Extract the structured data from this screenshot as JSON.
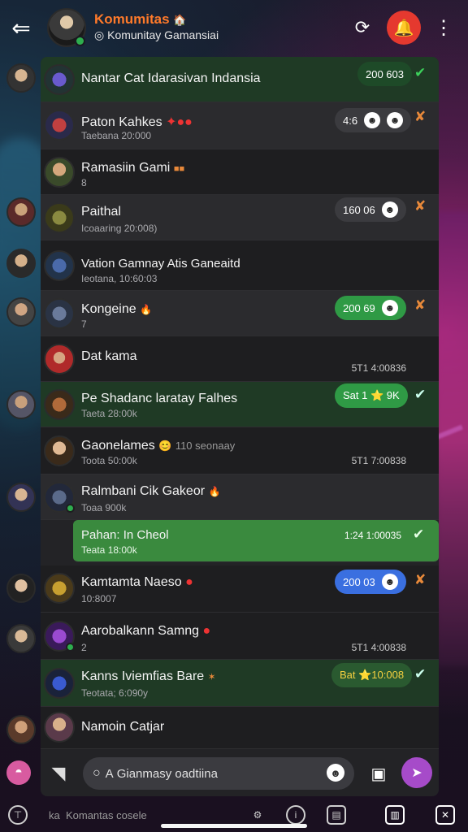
{
  "header": {
    "title": "Komumitas",
    "subtitle": "Komunitay Gamansiai",
    "title_badge": "🏠"
  },
  "chats": [
    {
      "name": "Nantar Cat Idarasivan Indansia",
      "sub": "",
      "pill": "200 603",
      "mark": "✔",
      "style": "green"
    },
    {
      "name": "Paton Kahkes",
      "emoji": "✦●●",
      "sub": "Taebana 20:000",
      "pill": "4:6",
      "mark": "✘",
      "style": "mid"
    },
    {
      "name": "Ramasiin Gami",
      "emoji": "■■",
      "sub": "8",
      "pill": "",
      "mark": "",
      "style": "dark"
    },
    {
      "name": "Paithal",
      "sub": "Icoaaring 20:008)",
      "pill": "160 06",
      "mark": "✘",
      "style": "mid"
    },
    {
      "name": "Vation Gamnay Atis Ganeaitd",
      "sub": "Ieotana, 10:60:03",
      "pill": "",
      "mark": "",
      "style": "dark"
    },
    {
      "name": "Kongeine",
      "emoji": "🔥",
      "sub": "7",
      "pill": "200 69",
      "mark": "✘",
      "style": "mid"
    },
    {
      "name": "Dat kama",
      "sub": "",
      "time": "5T1 4:00836",
      "pill": "",
      "mark": "",
      "style": "dark"
    },
    {
      "name": "Pe Shadanc laratay Falhes",
      "sub": "Taeta 28:00k",
      "pill": "Sat 1 ⭐ 9K",
      "mark": "✔",
      "style": "green"
    },
    {
      "name": "Gaonelames",
      "emoji": "😊",
      "extra": "110 seonaay",
      "sub": "Toota 50:00k",
      "time": "5T1 7:00838",
      "pill": "",
      "mark": "",
      "style": "dark"
    },
    {
      "name": "Ralmbani Cik Gakeor",
      "emoji": "🔥",
      "sub": "Toaa 900k",
      "pill": "",
      "mark": "",
      "style": "mid"
    },
    {
      "name": "Pahan: In Cheol",
      "sub": "Teata 18:00k",
      "time": "1:24 1:00035",
      "pill": "",
      "mark": "✔",
      "style": "bright"
    },
    {
      "name": "Kamtamta Naeso",
      "emoji": "●",
      "sub": "10:8007",
      "pill": "200 03",
      "mark": "✘",
      "style": "dark"
    },
    {
      "name": "Aarobalkann Samng",
      "emoji": "●",
      "sub": "2",
      "time": "5T1 4:00838",
      "pill": "",
      "mark": "",
      "style": "dark"
    },
    {
      "name": "Kanns Iviemfias Bare",
      "emoji": "✶",
      "sub": "Teotata; 6:090y",
      "pill": "Bat ⭐10:008",
      "mark": "✔",
      "style": "green"
    },
    {
      "name": "Namoin Catjar",
      "sub": "",
      "pill": "",
      "mark": "",
      "style": "dark"
    }
  ],
  "input": {
    "placeholder": "Gianmasy oadtiina",
    "prefix": "A"
  },
  "nav": {
    "left_text": "ka",
    "center_text": "Komantas cosele"
  },
  "colors": {
    "accent_orange": "#ff7a2a",
    "accent_red": "#e5392f",
    "accent_green": "#2f9a45",
    "accent_blue": "#3a6fe0",
    "accent_purple": "#a64bc9"
  },
  "icons": [
    "back-arrow-icon",
    "sync-icon",
    "bell-icon",
    "more-icon",
    "attach-icon",
    "search-icon",
    "emoji-icon",
    "camera-icon",
    "send-icon"
  ]
}
